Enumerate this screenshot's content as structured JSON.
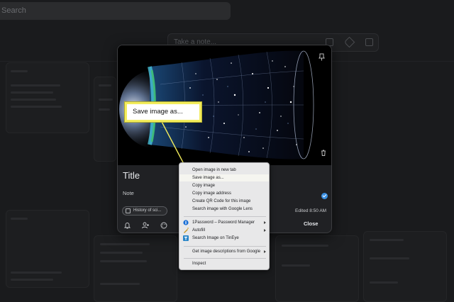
{
  "background": {
    "search_placeholder": "Search",
    "take_note_placeholder": "Take a note..."
  },
  "note": {
    "title": "Title",
    "body": "Note",
    "chip_label": "History of sci...",
    "edited": "Edited 8:50 AM",
    "close_label": "Close"
  },
  "callout": {
    "text": "Save image as...",
    "color": "#f2ec5c"
  },
  "context_menu": {
    "group1": [
      "Open image in new tab",
      "Save image as...",
      "Copy image",
      "Copy image address",
      "Create QR Code for this image",
      "Search image with Google Lens"
    ],
    "group2": [
      {
        "label": "1Password – Password Manager",
        "icon": "1password-icon",
        "submenu": true
      },
      {
        "label": "Autofill",
        "icon": "autofill-icon",
        "submenu": true
      },
      {
        "label": "Search Image on TinEye",
        "icon": "tineye-icon",
        "submenu": false
      }
    ],
    "group3": [
      {
        "label": "Get image descriptions from Google",
        "submenu": true
      }
    ],
    "group4": [
      {
        "label": "Inspect",
        "submenu": false
      }
    ]
  },
  "colors": {
    "page_bg": "#1a1b1d",
    "dialog_bg": "#202124",
    "menu_bg": "#e8e8e9",
    "accent_blue": "#3a8fe0",
    "callout_yellow": "#f2ec5c"
  }
}
